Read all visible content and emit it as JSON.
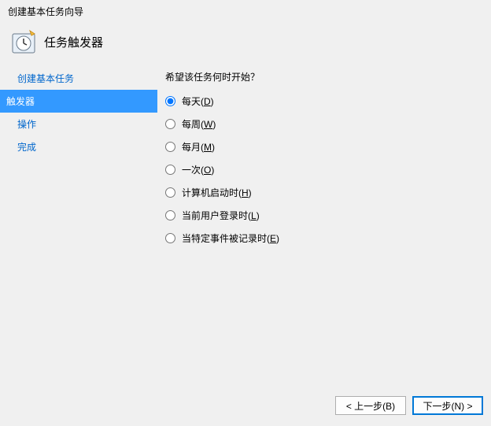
{
  "window": {
    "title": "创建基本任务向导"
  },
  "header": {
    "title": "任务触发器"
  },
  "sidebar": {
    "items": [
      {
        "label": "创建基本任务",
        "active": false
      },
      {
        "label": "触发器",
        "active": true
      },
      {
        "label": "操作",
        "active": false
      },
      {
        "label": "完成",
        "active": false
      }
    ]
  },
  "main": {
    "question": "希望该任务何时开始？",
    "options": [
      {
        "label": "每天",
        "accel": "D",
        "checked": true
      },
      {
        "label": "每周",
        "accel": "W",
        "checked": false
      },
      {
        "label": "每月",
        "accel": "M",
        "checked": false
      },
      {
        "label": "一次",
        "accel": "O",
        "checked": false
      },
      {
        "label": "计算机启动时",
        "accel": "H",
        "checked": false
      },
      {
        "label": "当前用户登录时",
        "accel": "L",
        "checked": false
      },
      {
        "label": "当特定事件被记录时",
        "accel": "E",
        "checked": false
      }
    ]
  },
  "footer": {
    "back_label": "< 上一步(B)",
    "next_label": "下一步(N) >"
  }
}
